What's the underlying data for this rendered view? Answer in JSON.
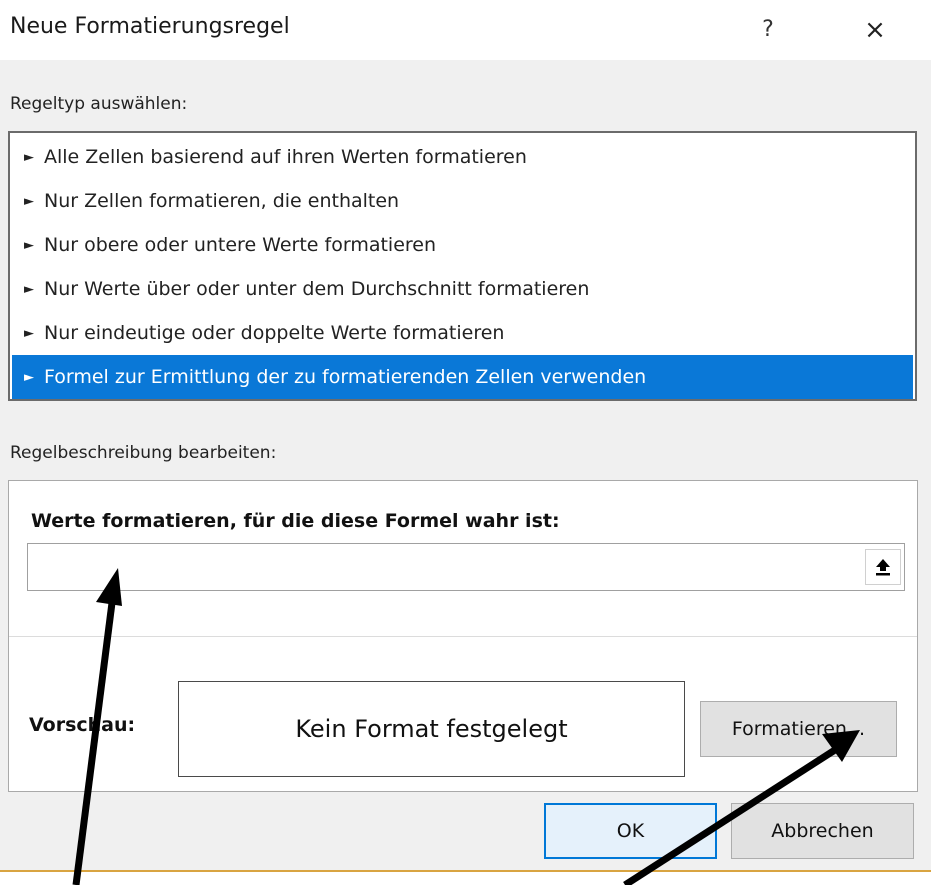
{
  "dialog": {
    "title": "Neue Formatierungsregel",
    "help_label": "?",
    "close_label": "×"
  },
  "rule_type": {
    "label": "Regeltyp auswählen:",
    "items": [
      {
        "label": "Alle Zellen basierend auf ihren Werten formatieren",
        "selected": false
      },
      {
        "label": "Nur Zellen formatieren, die enthalten",
        "selected": false
      },
      {
        "label": "Nur obere oder untere Werte formatieren",
        "selected": false
      },
      {
        "label": "Nur Werte über oder unter dem Durchschnitt formatieren",
        "selected": false
      },
      {
        "label": "Nur eindeutige oder doppelte Werte formatieren",
        "selected": false
      },
      {
        "label": "Formel zur Ermittlung der zu formatierenden Zellen verwenden",
        "selected": true
      }
    ]
  },
  "rule_description": {
    "label": "Regelbeschreibung bearbeiten:",
    "heading": "Werte formatieren, für die diese Formel wahr ist:",
    "formula_value": "",
    "preview_label": "Vorschau:",
    "preview_text": "Kein Format festgelegt",
    "format_button": "Formatieren..."
  },
  "buttons": {
    "ok": "OK",
    "cancel": "Abbrechen"
  },
  "colors": {
    "selection": "#0a78d7",
    "ok_border": "#0078d7"
  },
  "icons": {
    "collapse": "upload-arrow-icon",
    "list_bullet": "pointer-arrow-icon"
  }
}
